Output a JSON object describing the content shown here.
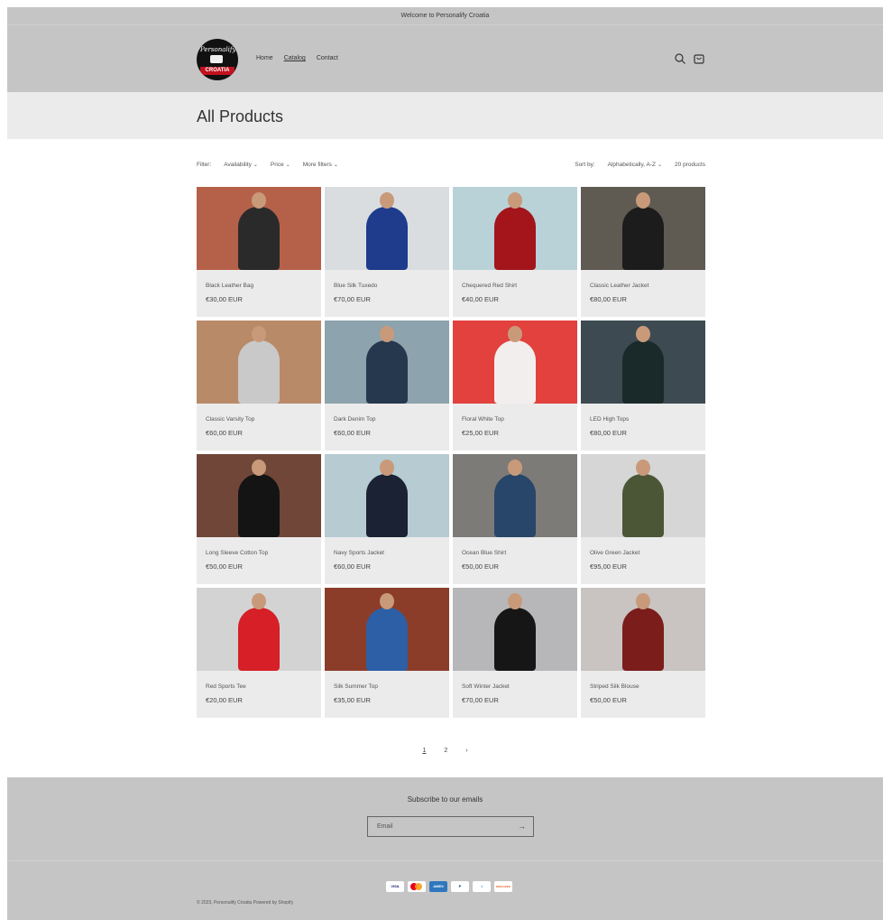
{
  "announcement": "Welcome to Personalify Croatia",
  "logo": {
    "script_text": "Personalify",
    "band_text": "CROATIA"
  },
  "nav": {
    "items": [
      "Home",
      "Catalog",
      "Contact"
    ],
    "active": "Catalog"
  },
  "header_icons": [
    "search-icon",
    "cart-icon"
  ],
  "page_title": "All Products",
  "filters": {
    "label": "Filter:",
    "availability": "Availability",
    "price": "Price",
    "more": "More filters",
    "sort_label": "Sort by:",
    "sort_value": "Alphabetically, A-Z",
    "count": "20 products"
  },
  "products": [
    {
      "name": "Black Leather Bag",
      "price": "€30,00 EUR",
      "bg": "#b5614a",
      "fig": "#2a2a2a"
    },
    {
      "name": "Blue Silk Tuxedo",
      "price": "€70,00 EUR",
      "bg": "#d9dde0",
      "fig": "#1f3b8c"
    },
    {
      "name": "Chequered Red Shirt",
      "price": "€40,00 EUR",
      "bg": "#b9d2d8",
      "fig": "#a3151b"
    },
    {
      "name": "Classic Leather Jacket",
      "price": "€80,00 EUR",
      "bg": "#5f5a52",
      "fig": "#1c1c1c"
    },
    {
      "name": "Classic Varsity Top",
      "price": "€60,00 EUR",
      "bg": "#b98a68",
      "fig": "#c9c9c9"
    },
    {
      "name": "Dark Denim Top",
      "price": "€60,00 EUR",
      "bg": "#8da3ad",
      "fig": "#26384e"
    },
    {
      "name": "Floral White Top",
      "price": "€25,00 EUR",
      "bg": "#e2413e",
      "fig": "#f2eeee"
    },
    {
      "name": "LED High Tops",
      "price": "€80,00 EUR",
      "bg": "#3d4a52",
      "fig": "#1a2a2a"
    },
    {
      "name": "Long Sleeve Cotton Top",
      "price": "€50,00 EUR",
      "bg": "#6f4638",
      "fig": "#141414"
    },
    {
      "name": "Navy Sports Jacket",
      "price": "€60,00 EUR",
      "bg": "#b6cbd2",
      "fig": "#1a2233"
    },
    {
      "name": "Ocean Blue Shirt",
      "price": "€50,00 EUR",
      "bg": "#7d7b78",
      "fig": "#27466a"
    },
    {
      "name": "Olive Green Jacket",
      "price": "€95,00 EUR",
      "bg": "#d6d6d6",
      "fig": "#4b5637"
    },
    {
      "name": "Red Sports Tee",
      "price": "€20,00 EUR",
      "bg": "#d3d3d3",
      "fig": "#d61f26"
    },
    {
      "name": "Silk Summer Top",
      "price": "€35,00 EUR",
      "bg": "#8c3d2a",
      "fig": "#2c5fa5"
    },
    {
      "name": "Soft Winter Jacket",
      "price": "€70,00 EUR",
      "bg": "#b7b7b9",
      "fig": "#161616"
    },
    {
      "name": "Striped Silk Blouse",
      "price": "€50,00 EUR",
      "bg": "#c9c3c1",
      "fig": "#7a1d1b"
    }
  ],
  "pagination": {
    "pages": [
      "1",
      "2"
    ],
    "current": "1",
    "next": "›"
  },
  "newsletter": {
    "heading": "Subscribe to our emails",
    "placeholder": "Email",
    "submit": "→"
  },
  "payments": [
    "VISA",
    "MC",
    "AMEX",
    "PayPal",
    "Diners",
    "DISCOVER"
  ],
  "footer": {
    "copyright": "© 2023, Personalify Croatia Powered by Shopify"
  }
}
